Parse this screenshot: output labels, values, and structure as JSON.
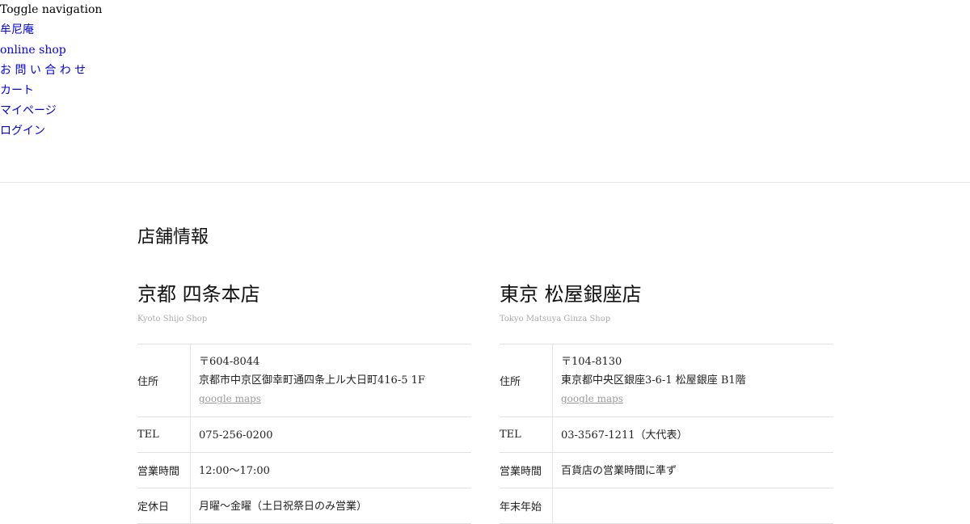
{
  "nav": {
    "toggle_label": "Toggle navigation",
    "links": [
      {
        "label": "牟尼庵"
      },
      {
        "label": "online shop"
      },
      {
        "label": "お 問 い 合 わ せ"
      },
      {
        "label": "カート"
      },
      {
        "label": "マイページ"
      },
      {
        "label": "ログイン"
      }
    ]
  },
  "page": {
    "title": "店舗情報"
  },
  "shops": [
    {
      "name": "京都 四条本店",
      "name_en": "Kyoto Shijo Shop",
      "address_label": "住所",
      "postal": "〒604-8044",
      "address": "京都市中京区御幸町通四条上ル大日町416-5 1F",
      "map_label": "google maps",
      "tel_label": "TEL",
      "tel": "075-256-0200",
      "hours_label": "営業時間",
      "hours": "12:00〜17:00",
      "closed_label": "定休日",
      "closed": "月曜〜金曜（土日祝祭日のみ営業）"
    },
    {
      "name": "東京 松屋銀座店",
      "name_en": "Tokyo Matsuya Ginza Shop",
      "address_label": "住所",
      "postal": "〒104-8130",
      "address": "東京都中央区銀座3-6-1 松屋銀座 B1階",
      "map_label": "google maps",
      "tel_label": "TEL",
      "tel": "03-3567-1211（大代表）",
      "hours_label": "営業時間",
      "hours": "百貨店の営業時間に準ず",
      "closed_label": "年末年始",
      "closed": ""
    }
  ],
  "colors": {
    "link": "#0000ee",
    "muted": "#999999",
    "divider": "#e2e2e2"
  }
}
